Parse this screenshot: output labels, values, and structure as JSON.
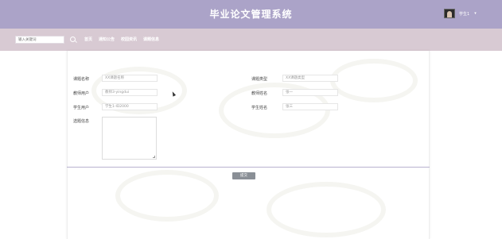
{
  "header": {
    "title": "毕业论文管理系统",
    "user_name": "学生1",
    "user_caret": "▾",
    "header_color": "#aba3c8",
    "nav_bg_color": "#d8cad3"
  },
  "search": {
    "placeholder": "输入关键词",
    "icon": "search-icon"
  },
  "nav": {
    "items": [
      "首页",
      "通知公告",
      "校园资讯",
      "课题信息"
    ]
  },
  "form": {
    "course_name_label": "课题名称",
    "course_name_value": "XX课题名称",
    "course_type_label": "课题类型",
    "course_type_value": "XX课题类型",
    "teacher_user_label": "教师用户",
    "teacher_user_value": "教师3-yingdui",
    "teacher_name_label": "教师姓名",
    "teacher_name_value": "张一",
    "student_user_label": "学生用户",
    "student_user_value": "学生1-ID2000",
    "student_name_label": "学生姓名",
    "student_name_value": "张三",
    "info_label": "选题信息",
    "submit_label": "提交",
    "submit_color": "#8a8f96"
  }
}
